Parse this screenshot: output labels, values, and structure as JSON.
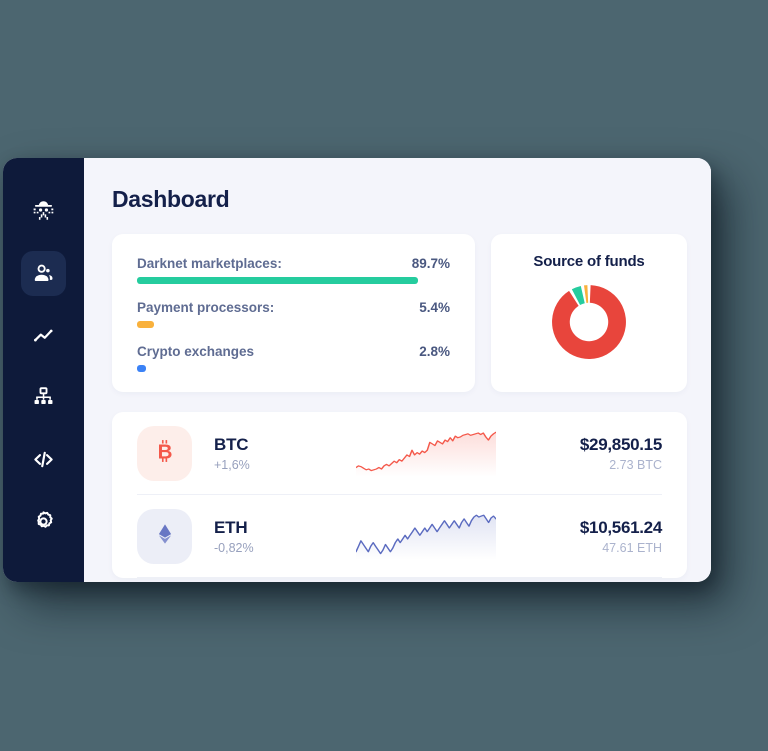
{
  "theme": {
    "page_background": "#4c6670",
    "sidebar_background": "#0e1a3a",
    "sidebar_active_background": "#1c2c51",
    "app_background": "#f4f5fb",
    "card_background": "#ffffff",
    "title_color": "#14204a",
    "accent_green": "#25cc9e",
    "accent_orange": "#f9b13c",
    "accent_blue": "#3b82f6",
    "accent_red": "#e8453c",
    "btc_color": "#f4584a",
    "eth_color": "#6876c4"
  },
  "sidebar": {
    "items": [
      {
        "id": "investigations",
        "icon": "spy-icon",
        "active": false
      },
      {
        "id": "entities",
        "icon": "people-icon",
        "active": true
      },
      {
        "id": "analytics",
        "icon": "line-chart-icon",
        "active": false
      },
      {
        "id": "graph",
        "icon": "org-chart-icon",
        "active": false
      },
      {
        "id": "developer",
        "icon": "code-icon",
        "active": false
      },
      {
        "id": "settings",
        "icon": "gear-icon",
        "active": false
      }
    ]
  },
  "header": {
    "title": "Dashboard"
  },
  "stats_card": {
    "rows": [
      {
        "label": "Darknet marketplaces:",
        "value": "89.7%",
        "pct": 89.7,
        "color": "#25cc9e"
      },
      {
        "label": "Payment processors:",
        "value": "5.4%",
        "pct": 5.4,
        "color": "#f9b13c"
      },
      {
        "label": "Crypto exchanges",
        "value": "2.8%",
        "pct": 2.8,
        "color": "#3b82f6"
      }
    ]
  },
  "chart_data": {
    "type": "pie",
    "title": "Source of funds",
    "labels": [
      "Darknet marketplaces",
      "Payment processors",
      "Crypto exchanges"
    ],
    "values": [
      89.7,
      5.4,
      2.8
    ],
    "colors": [
      "#e8453c",
      "#25cc9e",
      "#f9b13c"
    ],
    "donut": true,
    "inner_radius_ratio": 0.52,
    "legend": "none",
    "grid": false
  },
  "assets_card": {
    "rows": [
      {
        "ticker": "BTC",
        "icon": "bitcoin-icon",
        "change": "+1,6%",
        "fiat": "$29,850.15",
        "quantity": "2.73 BTC",
        "color": "#f4584a",
        "icon_background": "#fdeeea",
        "sparkline": [
          52,
          50,
          51,
          53,
          55,
          54,
          56,
          55,
          54,
          52,
          54,
          50,
          48,
          50,
          47,
          44,
          46,
          42,
          44,
          40,
          36,
          38,
          30,
          36,
          33,
          35,
          31,
          33,
          30,
          20,
          22,
          24,
          18,
          20,
          22,
          17,
          19,
          14,
          18,
          12,
          14,
          13,
          11,
          10,
          9,
          11,
          10,
          9,
          8,
          10,
          8,
          13,
          17,
          12,
          9,
          7
        ]
      },
      {
        "ticker": "ETH",
        "icon": "ethereum-icon",
        "change": "-0,82%",
        "fiat": "$10,561.24",
        "quantity": "47.61 ETH",
        "color": "#6876c4",
        "icon_background": "#eceef7",
        "sparkline": [
          48,
          42,
          36,
          40,
          44,
          48,
          42,
          38,
          42,
          46,
          50,
          46,
          40,
          44,
          48,
          44,
          38,
          34,
          38,
          34,
          30,
          34,
          30,
          26,
          22,
          26,
          30,
          26,
          22,
          26,
          22,
          18,
          22,
          26,
          22,
          18,
          14,
          18,
          22,
          18,
          14,
          18,
          22,
          16,
          12,
          16,
          20,
          14,
          10,
          8,
          10,
          9,
          8,
          12,
          16,
          11,
          9,
          12
        ]
      }
    ]
  }
}
